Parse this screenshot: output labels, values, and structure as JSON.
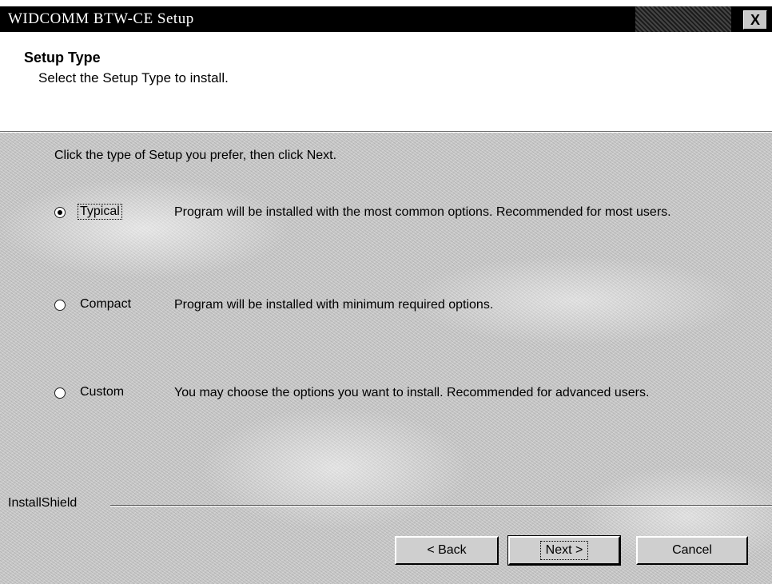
{
  "window": {
    "title": "WIDCOMM BTW-CE Setup",
    "close_glyph": "X"
  },
  "header": {
    "title": "Setup Type",
    "subtitle": "Select the Setup Type to install."
  },
  "body": {
    "instruction": "Click the type of Setup you prefer, then click Next.",
    "options": [
      {
        "label": "Typical",
        "selected": true,
        "description": "Program will be installed with the most common options.  Recommended for most users."
      },
      {
        "label": "Compact",
        "selected": false,
        "description": "Program will be installed with minimum required options."
      },
      {
        "label": "Custom",
        "selected": false,
        "description": "You may choose the options you want to install. Recommended for advanced users."
      }
    ]
  },
  "footer": {
    "brand": "InstallShield",
    "back_label": "< Back",
    "next_label": "Next >",
    "cancel_label": "Cancel"
  }
}
